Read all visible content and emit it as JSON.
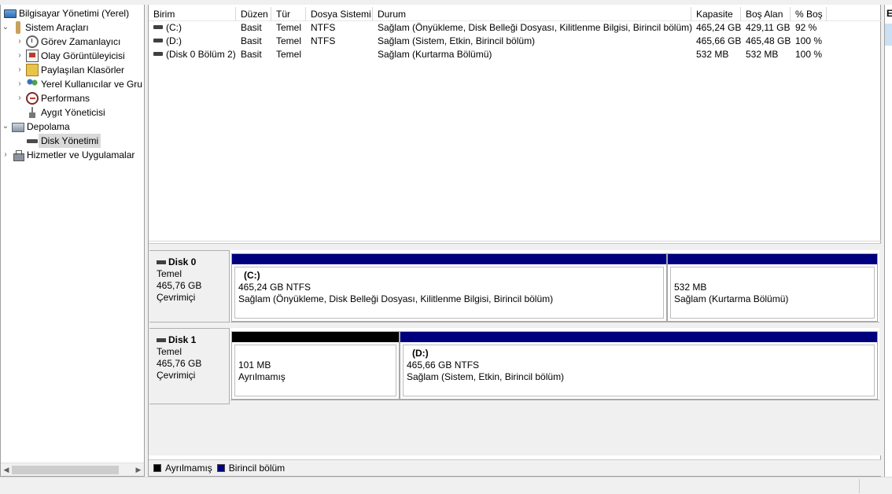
{
  "tree": {
    "items": [
      {
        "label": "Bilgisayar Yönetimi (Yerel)",
        "icon": "computer-management-icon",
        "expander": ""
      },
      {
        "label": "Sistem Araçları",
        "icon": "tools-icon",
        "expander": "⌄"
      },
      {
        "label": "Görev Zamanlayıcı",
        "icon": "clock-icon",
        "expander": "›"
      },
      {
        "label": "Olay Görüntüleyicisi",
        "icon": "event-viewer-icon",
        "expander": "›"
      },
      {
        "label": "Paylaşılan Klasörler",
        "icon": "shared-folder-icon",
        "expander": "›"
      },
      {
        "label": "Yerel Kullanıcılar ve Gru",
        "icon": "users-icon",
        "expander": "›"
      },
      {
        "label": "Performans",
        "icon": "performance-icon",
        "expander": "›"
      },
      {
        "label": "Aygıt Yöneticisi",
        "icon": "device-manager-icon",
        "expander": ""
      },
      {
        "label": "Depolama",
        "icon": "storage-icon",
        "expander": "⌄"
      },
      {
        "label": "Disk Yönetimi",
        "icon": "disk-management-icon",
        "expander": ""
      },
      {
        "label": "Hizmetler ve Uygulamalar",
        "icon": "services-icon",
        "expander": "›"
      }
    ]
  },
  "volumes": {
    "columns": [
      "Birim",
      "Düzen",
      "Tür",
      "Dosya Sistemi",
      "Durum",
      "Kapasite",
      "Boş Alan",
      "% Boş"
    ],
    "rows": [
      {
        "birim": "(C:)",
        "duzen": "Basit",
        "tur": "Temel",
        "fs": "NTFS",
        "durum": "Sağlam (Önyükleme, Disk Belleği Dosyası, Kilitlenme Bilgisi, Birincil bölüm)",
        "kapasite": "465,24 GB",
        "bos": "429,11 GB",
        "yuzde": "92 %"
      },
      {
        "birim": "(D:)",
        "duzen": "Basit",
        "tur": "Temel",
        "fs": "NTFS",
        "durum": "Sağlam (Sistem, Etkin, Birincil bölüm)",
        "kapasite": "465,66 GB",
        "bos": "465,48 GB",
        "yuzde": "100 %"
      },
      {
        "birim": "(Disk 0 Bölüm 2)",
        "duzen": "Basit",
        "tur": "Temel",
        "fs": "",
        "durum": "Sağlam (Kurtarma Bölümü)",
        "kapasite": "532 MB",
        "bos": "532 MB",
        "yuzde": "100 %"
      }
    ]
  },
  "disks": [
    {
      "name": "Disk 0",
      "type": "Temel",
      "size": "465,76 GB",
      "status": "Çevrimiçi",
      "partitions": [
        {
          "name": "(C:)",
          "size_fs": "465,24 GB NTFS",
          "status": "Sağlam (Önyükleme, Disk Belleği Dosyası, Kilitlenme Bilgisi, Birincil bölüm)",
          "kind": "primary"
        },
        {
          "name": "",
          "size_fs": "532 MB",
          "status": "Sağlam (Kurtarma Bölümü)",
          "kind": "primary"
        }
      ]
    },
    {
      "name": "Disk 1",
      "type": "Temel",
      "size": "465,76 GB",
      "status": "Çevrimiçi",
      "partitions": [
        {
          "name": "",
          "size_fs": "101 MB",
          "status": "Ayrılmamış",
          "kind": "unallocated"
        },
        {
          "name": "(D:)",
          "size_fs": "465,66 GB NTFS",
          "status": "Sağlam (Sistem, Etkin, Birincil bölüm)",
          "kind": "primary"
        }
      ]
    }
  ],
  "legend": {
    "unallocated": "Ayrılmamış",
    "primary": "Birincil bölüm"
  },
  "colors": {
    "primary": "#00007f",
    "unallocated": "#000000",
    "selection": "#d9d9d9"
  },
  "actions": {
    "header": "E"
  }
}
